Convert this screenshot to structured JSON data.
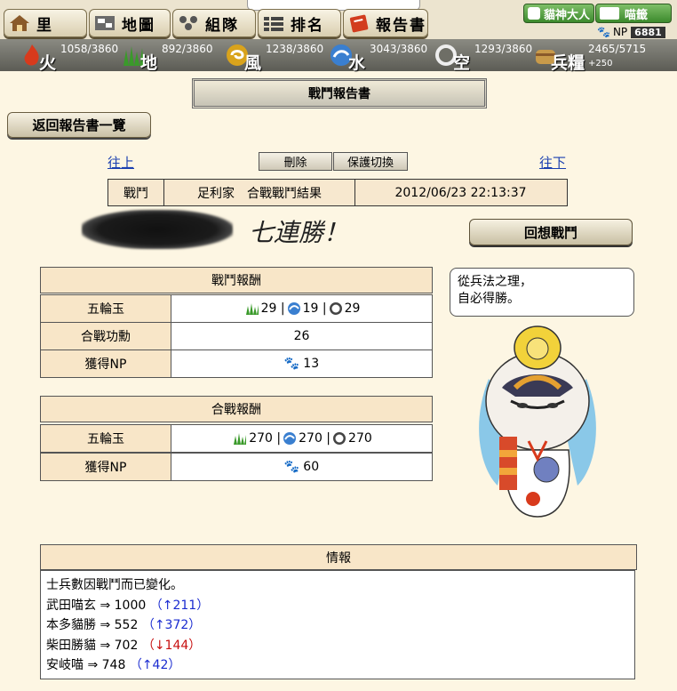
{
  "nav": {
    "items": [
      {
        "label": "里",
        "icon": "house-icon"
      },
      {
        "label": "地圖",
        "icon": "map-icon"
      },
      {
        "label": "組隊",
        "icon": "team-icon"
      },
      {
        "label": "排名",
        "icon": "ranking-icon"
      },
      {
        "label": "報告書",
        "icon": "report-icon"
      }
    ],
    "god_label": "貓神大人",
    "shop_label": "喵籤",
    "np_label": "NP",
    "np_value": "6881"
  },
  "resources": [
    {
      "label": "火",
      "value": "1058/3860",
      "icon": "fire-icon",
      "color": "#d83a1c"
    },
    {
      "label": "地",
      "value": "892/3860",
      "icon": "earth-icon",
      "color": "#3a9a2a"
    },
    {
      "label": "風",
      "value": "1238/3860",
      "icon": "wind-icon",
      "color": "#d9a31c"
    },
    {
      "label": "水",
      "value": "3043/3860",
      "icon": "water-icon",
      "color": "#3a7fd0"
    },
    {
      "label": "空",
      "value": "1293/3860",
      "icon": "sky-icon",
      "color": "#dddddd"
    },
    {
      "label": "兵糧",
      "value": "2465/5715",
      "sub": "+250",
      "icon": "rice-icon",
      "color": "#c89a4a"
    }
  ],
  "page_title": "戰鬥報告書",
  "back_label": "返回報告書一覽",
  "prev_link": "往上",
  "next_link": "往下",
  "delete_label": "刪除",
  "protect_label": "保護切換",
  "info_row": {
    "type": "戰鬥",
    "title": "足利家　合戰戰鬥結果",
    "date": "2012/06/23 22:13:37"
  },
  "streak_text": "七連勝！",
  "recall_label": "回想戰鬥",
  "battle_reward": {
    "title": "戰鬥報酬",
    "gems_label": "五輪玉",
    "earth": "29",
    "water": "19",
    "sky": "29",
    "merit_label": "合戰功勳",
    "merit": "26",
    "np_label": "獲得NP",
    "np": "13"
  },
  "war_reward": {
    "title": "合戰報酬",
    "gems_label": "五輪玉",
    "earth": "270",
    "water": "270",
    "sky": "270",
    "np_label": "獲得NP",
    "np": "60"
  },
  "speech": {
    "line1": "從兵法之理，",
    "line2": "自必得勝。"
  },
  "info": {
    "title": "情報",
    "intro": "士兵數因戰鬥而已變化。",
    "units": [
      {
        "name": "武田喵玄",
        "value": "1000",
        "delta": "↑211",
        "dir": "up"
      },
      {
        "name": "本多貓勝",
        "value": "552",
        "delta": "↑372",
        "dir": "up"
      },
      {
        "name": "柴田勝貓",
        "value": "702",
        "delta": "↓144",
        "dir": "down"
      },
      {
        "name": "安岐喵",
        "value": "748",
        "delta": "↑42",
        "dir": "up"
      }
    ]
  }
}
